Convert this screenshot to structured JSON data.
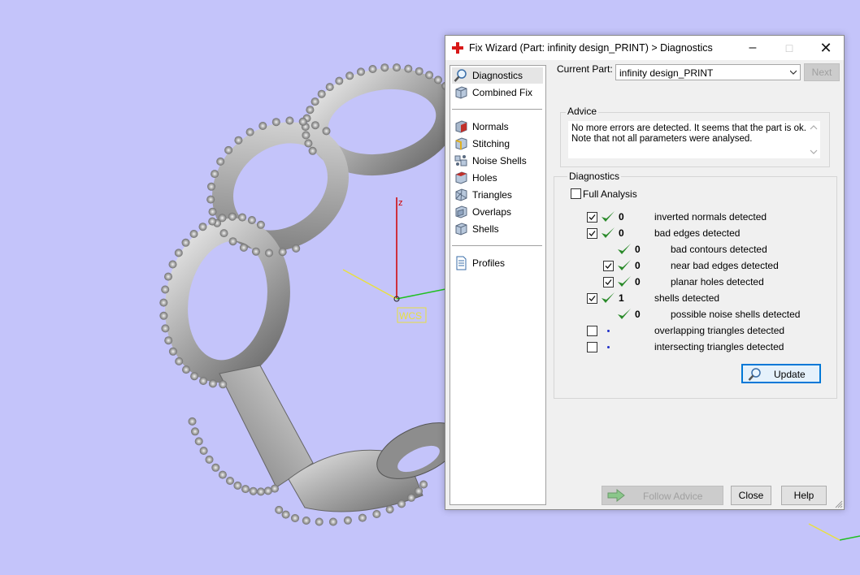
{
  "window": {
    "title": "Fix Wizard (Part: infinity design_PRINT) > Diagnostics",
    "minimize": "–",
    "maximize": "□",
    "close": "✕"
  },
  "viewport": {
    "axis_z_label": "z",
    "wcs_label": "WCS",
    "colors": {
      "background": "#c4c4fa",
      "axis_z": "#d00000",
      "axis_x": "#e8e040",
      "axis_y": "#20c020"
    }
  },
  "nav": {
    "top": [
      {
        "label": "Diagnostics",
        "icon": "magnifier-icon",
        "selected": true
      },
      {
        "label": "Combined Fix",
        "icon": "cube-icon",
        "selected": false
      }
    ],
    "tools": [
      {
        "label": "Normals",
        "icon": "normals-cube-icon"
      },
      {
        "label": "Stitching",
        "icon": "stitching-cube-icon"
      },
      {
        "label": "Noise Shells",
        "icon": "noise-shells-icon"
      },
      {
        "label": "Holes",
        "icon": "holes-cube-icon"
      },
      {
        "label": "Triangles",
        "icon": "triangles-cube-icon"
      },
      {
        "label": "Overlaps",
        "icon": "overlaps-cube-icon"
      },
      {
        "label": "Shells",
        "icon": "shells-cube-icon"
      }
    ],
    "bottom": [
      {
        "label": "Profiles",
        "icon": "document-icon"
      }
    ]
  },
  "header": {
    "current_part_label": "Current Part:",
    "current_part_value": "infinity design_PRINT",
    "next_label": "Next"
  },
  "advice": {
    "group_label": "Advice",
    "line1": "No more errors are detected. It seems that the part is ok.",
    "line2": "Note that not all parameters were analysed."
  },
  "diagnostics": {
    "group_label": "Diagnostics",
    "full_analysis_label": "Full Analysis",
    "full_analysis_checked": false,
    "rows": [
      {
        "checkbox": true,
        "checked": true,
        "status": "ok",
        "count": "0",
        "label": "inverted normals detected",
        "indent": 0
      },
      {
        "checkbox": true,
        "checked": true,
        "status": "ok",
        "count": "0",
        "label": "bad edges detected",
        "indent": 0
      },
      {
        "checkbox": false,
        "checked": false,
        "status": "ok",
        "count": "0",
        "label": "bad contours detected",
        "indent": 1
      },
      {
        "checkbox": true,
        "checked": true,
        "status": "ok",
        "count": "0",
        "label": "near bad edges detected",
        "indent": 1
      },
      {
        "checkbox": true,
        "checked": true,
        "status": "ok",
        "count": "0",
        "label": "planar holes detected",
        "indent": 1
      },
      {
        "checkbox": true,
        "checked": true,
        "status": "ok",
        "count": "1",
        "label": "shells detected",
        "indent": 0
      },
      {
        "checkbox": false,
        "checked": false,
        "status": "ok",
        "count": "0",
        "label": "possible noise shells detected",
        "indent": 1
      },
      {
        "checkbox": true,
        "checked": false,
        "status": "pending",
        "count": "",
        "label": "overlapping triangles detected",
        "indent": 0
      },
      {
        "checkbox": true,
        "checked": false,
        "status": "pending",
        "count": "",
        "label": "intersecting triangles detected",
        "indent": 0
      }
    ],
    "update_label": "Update"
  },
  "footer": {
    "follow_advice_label": "Follow Advice",
    "close_label": "Close",
    "help_label": "Help"
  }
}
